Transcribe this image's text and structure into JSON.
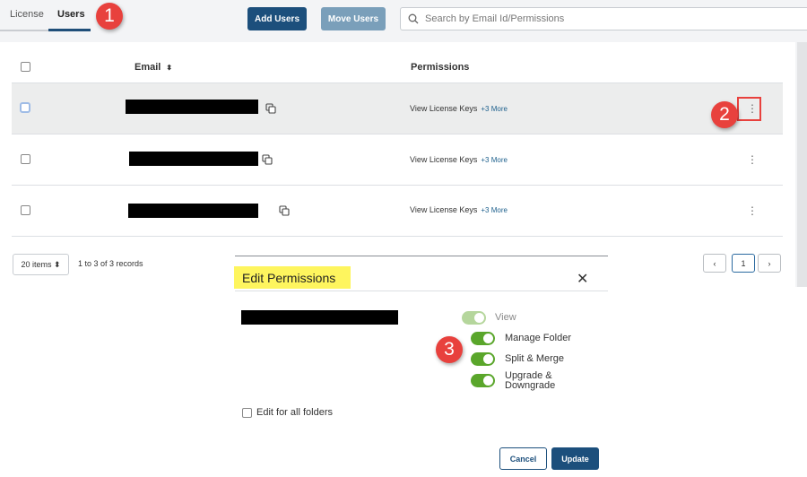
{
  "tabs": [
    {
      "label": "License"
    },
    {
      "label": "Users"
    }
  ],
  "callouts": [
    "1",
    "2",
    "3"
  ],
  "toolbar": {
    "add_users": "Add Users",
    "move_users": "Move Users"
  },
  "search": {
    "placeholder": "Search by Email Id/Permissions"
  },
  "table": {
    "headers": {
      "email": "Email",
      "sort_glyph": "⬍",
      "permissions": "Permissions"
    },
    "rows": [
      {
        "permission": "View License Keys",
        "more": "+3 More"
      },
      {
        "permission": "View License Keys",
        "more": "+3 More"
      },
      {
        "permission": "View License Keys",
        "more": "+3 More"
      }
    ],
    "row_menu_glyph": "⋮"
  },
  "pagination": {
    "page_size": "20 items ⬍",
    "records": "1 to 3 of 3 records",
    "prev": "‹",
    "current_page": "1",
    "next": "›"
  },
  "modal": {
    "title": "Edit Permissions",
    "close": "✕",
    "permissions": [
      {
        "label": "View",
        "enabled": true,
        "disabled": true
      },
      {
        "label": "Manage Folder",
        "enabled": true,
        "disabled": false
      },
      {
        "label": "Split & Merge",
        "enabled": true,
        "disabled": false
      },
      {
        "label": "Upgrade & Downgrade",
        "enabled": true,
        "disabled": false
      }
    ],
    "edit_all_label": "Edit for all folders",
    "cancel": "Cancel",
    "update": "Update"
  },
  "colors": {
    "primary": "#1c4f7c",
    "callout": "#e8413d",
    "toggle_on": "#5aa62b",
    "highlight": "#fef55e"
  }
}
